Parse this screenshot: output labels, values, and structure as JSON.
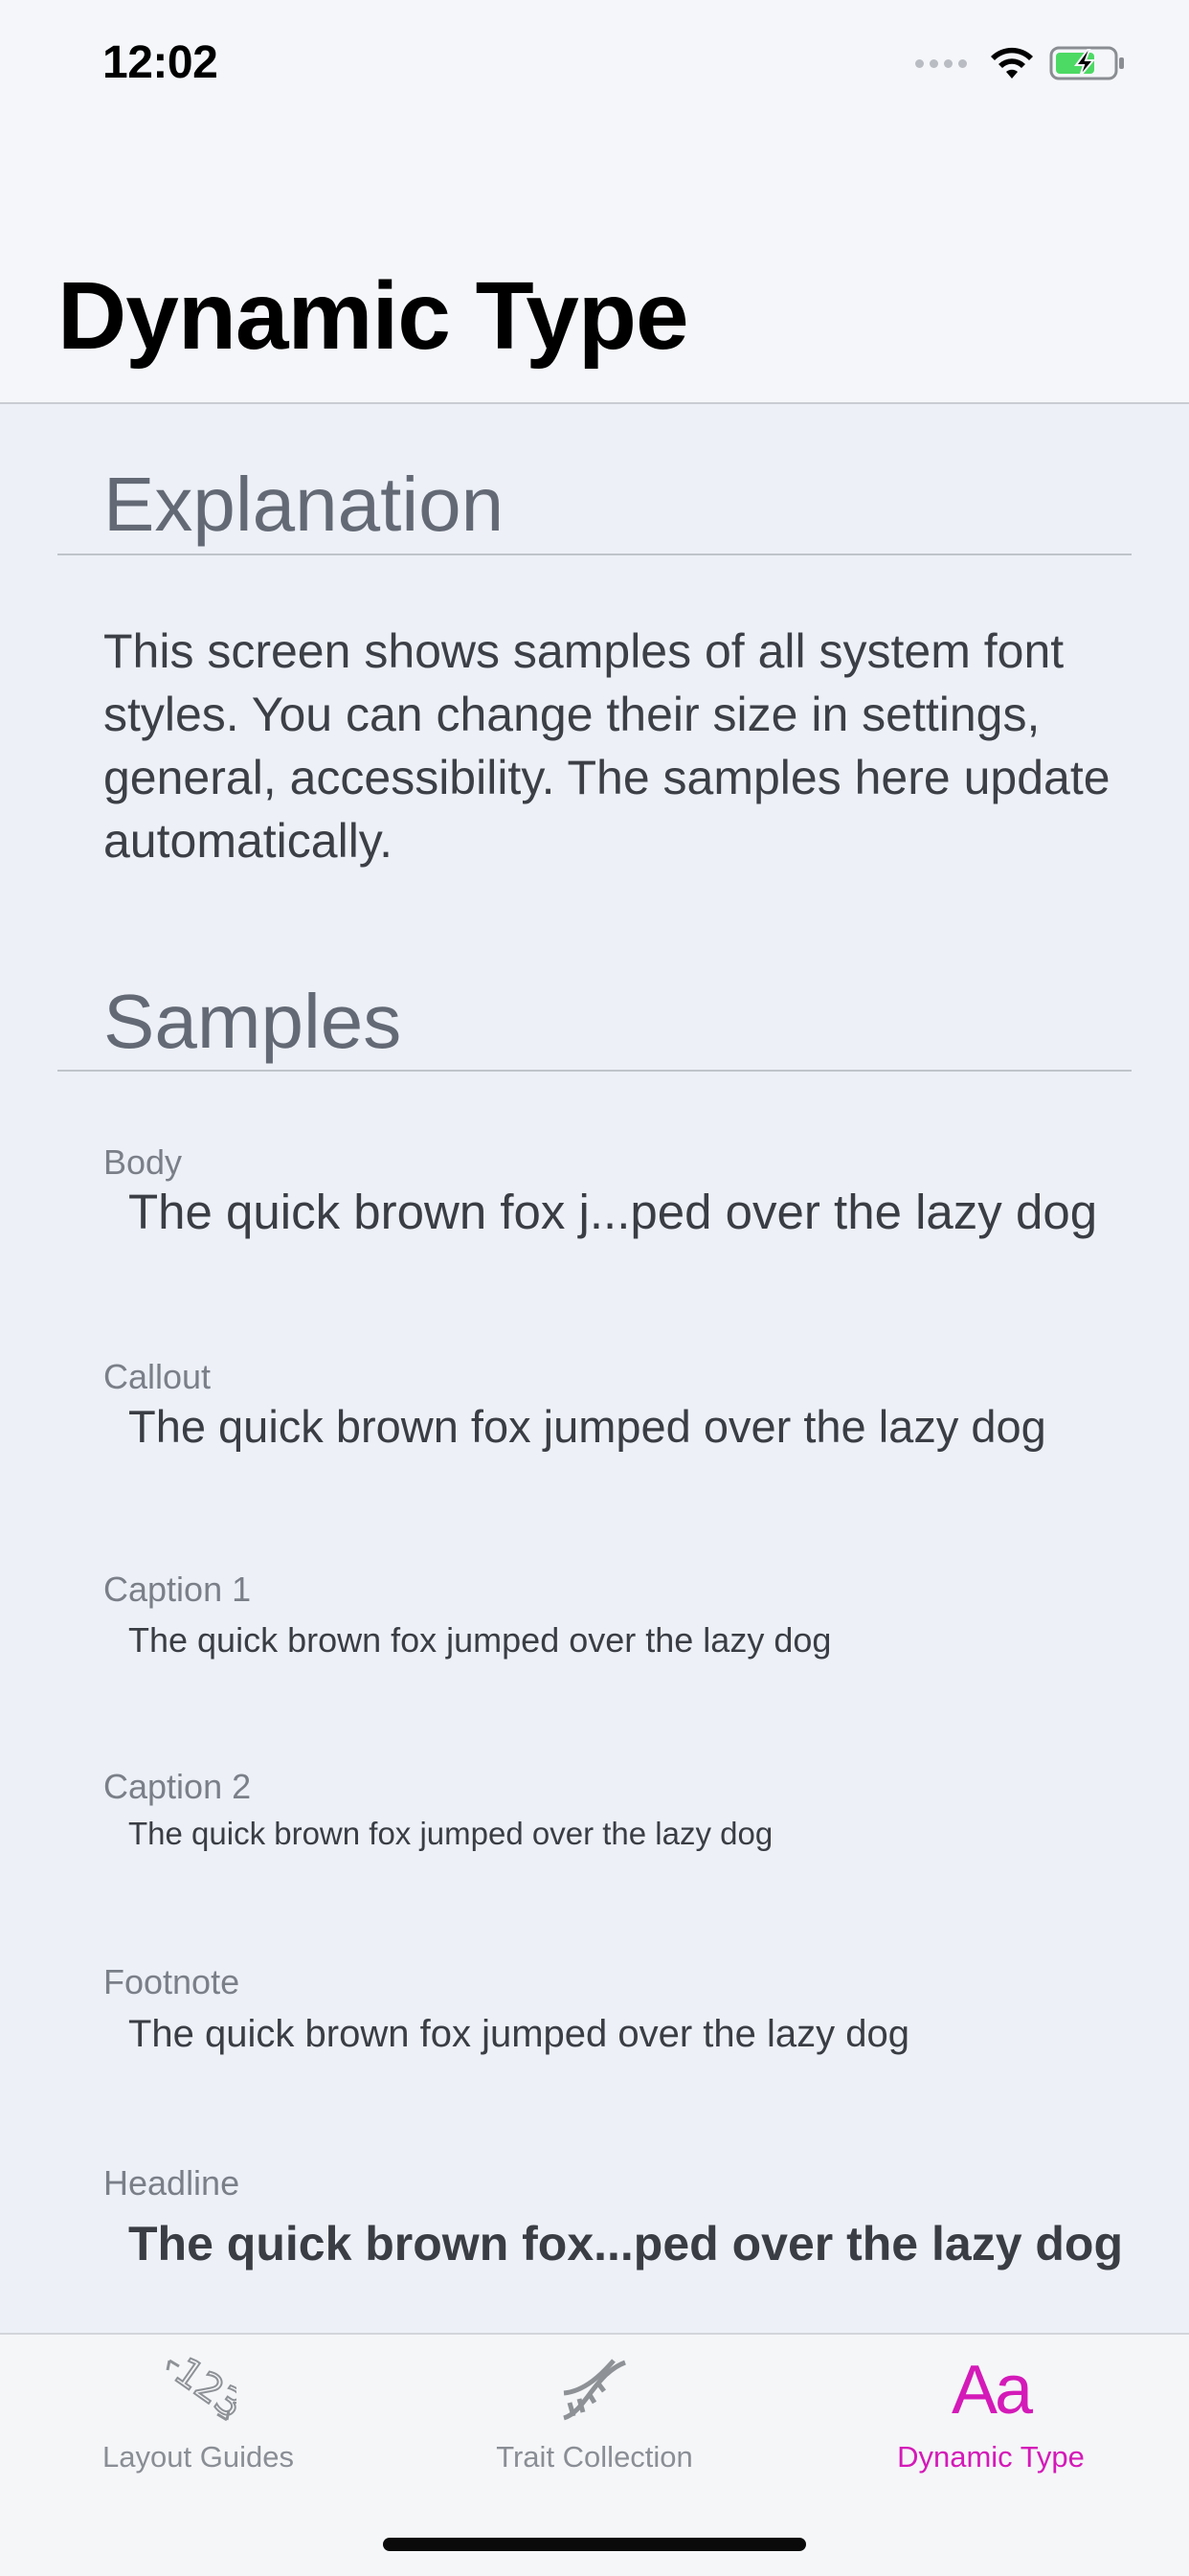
{
  "status_bar": {
    "time": "12:02",
    "signal_icon": "cellular-dots-icon",
    "wifi_icon": "wifi-icon",
    "battery_icon": "battery-charging-icon"
  },
  "nav": {
    "title": "Dynamic Type"
  },
  "sections": {
    "explanation_title": "Explanation",
    "explanation_text": "This screen shows samples of all system font styles. You can change their size in settings, general, accessibility. The samples here update automatically.",
    "samples_title": "Samples"
  },
  "samples": [
    {
      "label": "Body",
      "text": "The quick brown fox j...ped over the lazy dog"
    },
    {
      "label": "Callout",
      "text": "The quick brown fox jumped over the lazy dog"
    },
    {
      "label": "Caption 1",
      "text": "The quick brown fox jumped over the lazy dog"
    },
    {
      "label": "Caption 2",
      "text": "The quick brown fox jumped over the lazy dog"
    },
    {
      "label": "Footnote",
      "text": "The quick brown fox jumped over the lazy dog"
    },
    {
      "label": "Headline",
      "text": "The quick brown fox...ped over the lazy dog"
    }
  ],
  "tabbar": {
    "items": [
      {
        "label": "Layout Guides",
        "icon": "layout-guides-icon",
        "active": false
      },
      {
        "label": "Trait Collection",
        "icon": "dna-icon",
        "active": false
      },
      {
        "label": "Dynamic Type",
        "icon": "Aa",
        "active": true
      }
    ]
  },
  "colors": {
    "accent": "#d41ab8",
    "background": "#edf0f7",
    "section_title": "#646a75"
  }
}
